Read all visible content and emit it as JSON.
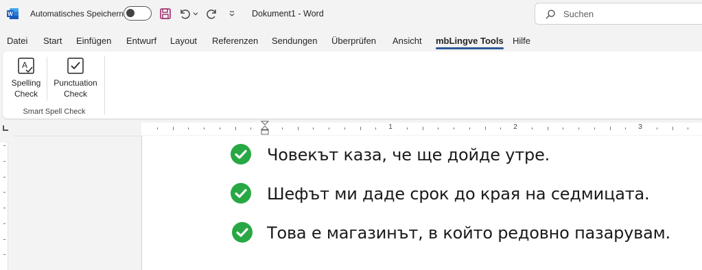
{
  "titlebar": {
    "autosave_label": "Automatisches Speichern",
    "document_title": "Dokument1  -  Word",
    "search_placeholder": "Suchen"
  },
  "tabs": [
    {
      "label": "Datei"
    },
    {
      "label": "Start"
    },
    {
      "label": "Einfügen"
    },
    {
      "label": "Entwurf"
    },
    {
      "label": "Layout"
    },
    {
      "label": "Referenzen"
    },
    {
      "label": "Sendungen"
    },
    {
      "label": "Überprüfen"
    },
    {
      "label": "Ansicht"
    },
    {
      "label": "mbLingve Tools",
      "active": true
    },
    {
      "label": "Hilfe"
    }
  ],
  "ribbon": {
    "spelling_label_1": "Spelling",
    "spelling_label_2": "Check",
    "punctuation_label_1": "Punctuation",
    "punctuation_label_2": "Check",
    "group_label": "Smart Spell Check"
  },
  "ruler": {
    "labels": [
      "1",
      "2",
      "3"
    ]
  },
  "document": {
    "lines": [
      "Човекът каза, че ще дойде утре.",
      "Шефът ми даде срок до края на седмицата.",
      "Това е магазинът, в който редовно пазарувам."
    ]
  },
  "colors": {
    "accent": "#2b579a",
    "check_green": "#27a844",
    "word_blue": "#185abd"
  }
}
